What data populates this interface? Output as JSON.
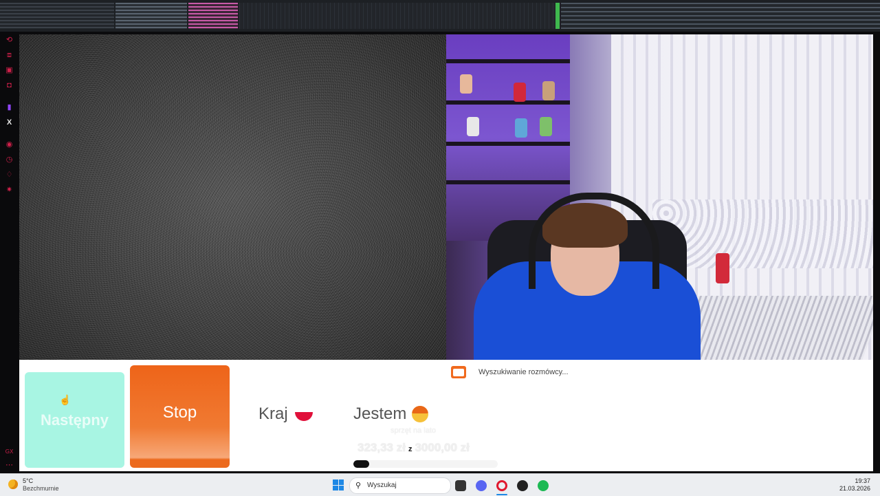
{
  "chat": {
    "next_label": "Następny",
    "stop_label": "Stop",
    "country_label": "Kraj",
    "gender_label": "Jestem",
    "searching_text": "Wyszukiwanie rozmówcy...",
    "country_flag": "poland-flag-icon",
    "colors": {
      "next": "#a8f5e3",
      "stop": "#ee6419",
      "panel": "#ffffff"
    }
  },
  "goal": {
    "title": "sprzęt na lato",
    "current": "323,33 zł",
    "separator": "z",
    "target": "3000,00 zł",
    "progress": 0.11
  },
  "taskbar": {
    "weather_temp": "5°C",
    "weather_desc": "Bezchmurnie",
    "search_placeholder": "Wyszukaj",
    "time": "19:37",
    "date": "21.03.2026",
    "apps": [
      "file-explorer-icon",
      "discord-icon",
      "opera-gx-icon",
      "obs-icon",
      "spotify-icon"
    ]
  }
}
